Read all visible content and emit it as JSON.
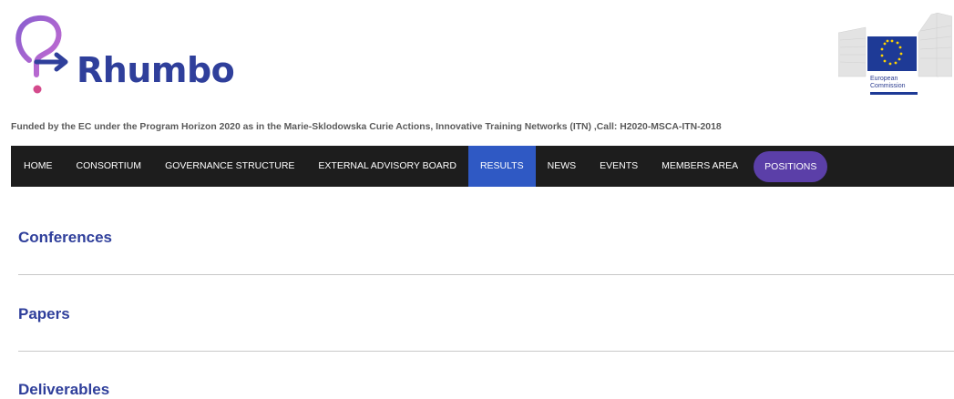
{
  "header": {
    "brand": "Rhumbo",
    "ec_caption_line1": "European",
    "ec_caption_line2": "Commission",
    "funded_text": "Funded by the EC under the Program Horizon 2020 as in the Marie-Sklodowska Curie Actions, Innovative Training Networks (ITN) ,Call: H2020-MSCA-ITN-2018"
  },
  "nav": {
    "items": [
      {
        "label": "HOME"
      },
      {
        "label": "CONSORTIUM"
      },
      {
        "label": "GOVERNANCE STRUCTURE"
      },
      {
        "label": "EXTERNAL ADVISORY BOARD"
      },
      {
        "label": "RESULTS",
        "active": true
      },
      {
        "label": "NEWS"
      },
      {
        "label": "EVENTS"
      },
      {
        "label": "MEMBERS AREA"
      },
      {
        "label": "POSITIONS",
        "highlight": true
      }
    ]
  },
  "sections": [
    {
      "title": "Conferences"
    },
    {
      "title": "Papers"
    },
    {
      "title": "Deliverables"
    }
  ],
  "colors": {
    "brand_blue": "#2f3f9b",
    "nav_bg": "#1d1d1d",
    "active_bg": "#2f59c4",
    "positions_bg": "#5b3fa8",
    "logo_purple": "#9a6fd1",
    "logo_pink": "#d44a8c"
  },
  "icons": {
    "logo_mark": "rhumbo-arrow-logo-icon",
    "ec_logo": "european-commission-logo-icon"
  }
}
